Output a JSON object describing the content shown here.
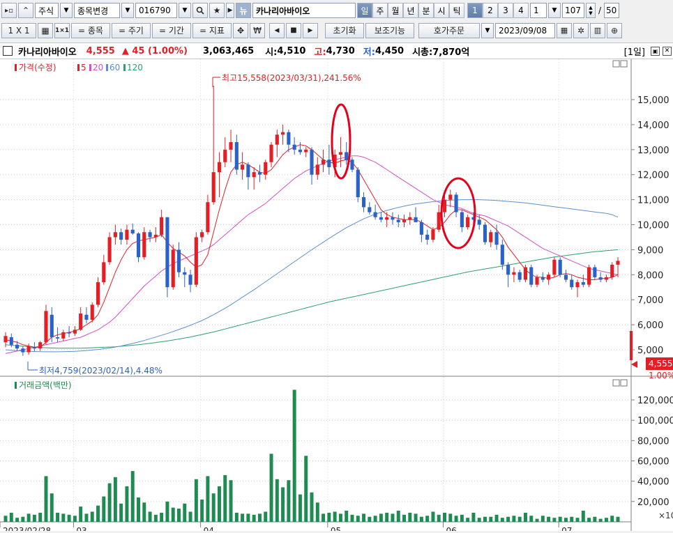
{
  "toolbar1": {
    "market": "주식",
    "change_label": "종목변경",
    "code": "016790",
    "news": "뉴",
    "name": "카나리아바이오",
    "periods": [
      "일",
      "주",
      "월",
      "년",
      "분",
      "시",
      "틱"
    ],
    "nums": [
      "1",
      "2",
      "3",
      "4"
    ],
    "num_value": "1",
    "count": "107",
    "slash": "/",
    "page": "50"
  },
  "toolbar2": {
    "layout": "1 X 1",
    "items_label": "= 종목",
    "cycle_label": "= 주기",
    "period_label": "= 기간",
    "indicator_label": "= 지표",
    "won": "₩",
    "reset": "초기화",
    "aux": "보조기능",
    "quote": "호가주문",
    "date": "2023/09/08"
  },
  "info": {
    "name": "카나리아바이오",
    "price": "4,555",
    "change": "▲ 45 (1.00%)",
    "volume": "3,063,465",
    "open_label": "시:",
    "open": "4,510",
    "high_label": "고:",
    "high": "4,730",
    "low_label": "저:",
    "low": "4,450",
    "mcap_label": "시총:",
    "mcap": "7,870억",
    "period": "[1일]"
  },
  "price_panel": {
    "legend_main": "가격(수정)",
    "legend_ma": [
      "5",
      "20",
      "60",
      "120"
    ],
    "high_note": "최고15,558(2023/03/31),241.56%",
    "low_note": "최저4,759(2023/02/14),4.48%",
    "current_price": "4,555",
    "current_pct": "1.00%"
  },
  "volume_panel": {
    "legend": "거래금액(백만)",
    "axis_unit": "×10"
  },
  "colors": {
    "up": "#e31e24",
    "down": "#2a62c9",
    "ma5": "#e31e24",
    "ma20": "#d14fc9",
    "ma60": "#5b8fcf",
    "ma120": "#2e9e6e",
    "volume": "#1f8a52",
    "circle": "#e5001a"
  },
  "chart_data": {
    "type": "candlestick",
    "price_axis_ticks": [
      "15,000",
      "14,000",
      "13,000",
      "12,000",
      "11,000",
      "10,000",
      "9,000",
      "8,000",
      "7,000",
      "6,000",
      "5,000"
    ],
    "volume_axis_ticks": [
      "120,000",
      "100,000",
      "80,000",
      "60,000",
      "40,000",
      "20,000"
    ],
    "x_labels": [
      "2023/02/28",
      "03",
      "04",
      "05",
      "06",
      "07"
    ],
    "ohlc": [
      [
        5300,
        5700,
        5100,
        5550
      ],
      [
        5500,
        5650,
        5100,
        5200
      ],
      [
        5200,
        5350,
        4950,
        5050
      ],
      [
        5050,
        5150,
        4759,
        4900
      ],
      [
        4900,
        5250,
        4800,
        5150
      ],
      [
        5100,
        5300,
        4950,
        5050
      ],
      [
        5050,
        5350,
        4950,
        5300
      ],
      [
        5300,
        6800,
        5200,
        6550
      ],
      [
        6400,
        6700,
        5300,
        5500
      ],
      [
        5500,
        5900,
        5300,
        5450
      ],
      [
        5450,
        5800,
        5350,
        5700
      ],
      [
        5700,
        5950,
        5500,
        5650
      ],
      [
        5650,
        5950,
        5550,
        5800
      ],
      [
        5800,
        6700,
        5750,
        6450
      ],
      [
        6400,
        6700,
        6050,
        6200
      ],
      [
        6200,
        6900,
        6100,
        6800
      ],
      [
        6800,
        7900,
        6700,
        7700
      ],
      [
        7700,
        8800,
        7600,
        8500
      ],
      [
        8500,
        9700,
        8400,
        9500
      ],
      [
        9500,
        10000,
        9200,
        9700
      ],
      [
        9700,
        9850,
        9200,
        9400
      ],
      [
        9400,
        10000,
        9200,
        9800
      ],
      [
        9800,
        10050,
        9600,
        9650
      ],
      [
        9650,
        9700,
        8500,
        8700
      ],
      [
        8700,
        9900,
        8600,
        9700
      ],
      [
        9700,
        9800,
        9300,
        9500
      ],
      [
        9500,
        9900,
        9300,
        9600
      ],
      [
        9600,
        10600,
        9500,
        10300
      ],
      [
        10300,
        10300,
        7100,
        7500
      ],
      [
        7500,
        9200,
        7400,
        9000
      ],
      [
        9000,
        9300,
        7900,
        8100
      ],
      [
        8100,
        8300,
        7500,
        8000
      ],
      [
        8000,
        8200,
        7300,
        7600
      ],
      [
        7600,
        9700,
        7500,
        9500
      ],
      [
        9500,
        9800,
        9300,
        9700
      ],
      [
        9700,
        11200,
        9600,
        10900
      ],
      [
        10900,
        15558,
        10800,
        12100
      ],
      [
        12100,
        12900,
        11100,
        12500
      ],
      [
        12500,
        13500,
        12300,
        13000
      ],
      [
        13000,
        13800,
        12500,
        13300
      ],
      [
        13300,
        13600,
        12000,
        12200
      ],
      [
        12200,
        12900,
        11800,
        12400
      ],
      [
        12400,
        12500,
        11400,
        11900
      ],
      [
        11900,
        12300,
        11400,
        12100
      ],
      [
        12100,
        12400,
        11700,
        12000
      ],
      [
        12000,
        12600,
        11800,
        12500
      ],
      [
        12500,
        13300,
        12300,
        13200
      ],
      [
        13200,
        13800,
        12700,
        13600
      ],
      [
        13600,
        14000,
        13200,
        13700
      ],
      [
        13700,
        13800,
        12900,
        13200
      ],
      [
        13200,
        13500,
        12800,
        13000
      ],
      [
        13000,
        13300,
        12800,
        12900
      ],
      [
        12900,
        13100,
        12700,
        13000
      ],
      [
        13000,
        13100,
        11600,
        12000
      ],
      [
        12000,
        12700,
        11800,
        12400
      ],
      [
        12400,
        13000,
        12100,
        12600
      ],
      [
        12600,
        13200,
        12000,
        12300
      ],
      [
        12300,
        13000,
        11900,
        12800
      ],
      [
        12800,
        13500,
        12300,
        12900
      ],
      [
        12900,
        13300,
        12400,
        12600
      ],
      [
        12600,
        12700,
        12100,
        12200
      ],
      [
        12200,
        12300,
        10900,
        11100
      ],
      [
        11100,
        11300,
        10500,
        10700
      ],
      [
        10700,
        10900,
        10400,
        10500
      ],
      [
        10500,
        10800,
        10200,
        10300
      ],
      [
        10300,
        10500,
        10100,
        10200
      ],
      [
        10200,
        10500,
        9900,
        10300
      ],
      [
        10300,
        10500,
        10000,
        10200
      ],
      [
        10200,
        10400,
        9900,
        10100
      ],
      [
        10100,
        10400,
        9900,
        10200
      ],
      [
        10200,
        10500,
        10000,
        10300
      ],
      [
        10300,
        10700,
        10100,
        10100
      ],
      [
        10100,
        10200,
        9300,
        9600
      ],
      [
        9600,
        9800,
        9200,
        9400
      ],
      [
        9400,
        9900,
        9300,
        9800
      ],
      [
        9800,
        10800,
        9700,
        10500
      ],
      [
        10500,
        11300,
        10300,
        11000
      ],
      [
        11000,
        11400,
        10700,
        11200
      ],
      [
        11200,
        11300,
        10300,
        10500
      ],
      [
        10500,
        10600,
        9700,
        9900
      ],
      [
        9900,
        10400,
        9800,
        10300
      ],
      [
        10300,
        10500,
        10000,
        10200
      ],
      [
        10200,
        10400,
        9800,
        10000
      ],
      [
        10000,
        10100,
        9200,
        9300
      ],
      [
        9300,
        9800,
        9100,
        9700
      ],
      [
        9700,
        10000,
        9000,
        9200
      ],
      [
        9200,
        9400,
        8200,
        8400
      ],
      [
        8400,
        8500,
        7500,
        8000
      ],
      [
        8000,
        8300,
        7700,
        8100
      ],
      [
        8100,
        8200,
        7700,
        7800
      ],
      [
        7800,
        8400,
        7700,
        8300
      ],
      [
        8300,
        8400,
        7500,
        7600
      ],
      [
        7600,
        8000,
        7500,
        7900
      ],
      [
        7900,
        8100,
        7700,
        7800
      ],
      [
        7800,
        8100,
        7600,
        8000
      ],
      [
        8000,
        8700,
        7900,
        8600
      ],
      [
        8600,
        8700,
        7900,
        8000
      ],
      [
        8000,
        8200,
        7700,
        7800
      ],
      [
        7800,
        8000,
        7400,
        7500
      ],
      [
        7500,
        7800,
        7100,
        7700
      ],
      [
        7700,
        8000,
        7500,
        7600
      ],
      [
        7600,
        8400,
        7500,
        8300
      ],
      [
        8300,
        8400,
        7800,
        7900
      ],
      [
        7900,
        8100,
        7700,
        7800
      ],
      [
        7800,
        8000,
        7700,
        7900
      ],
      [
        7900,
        8500,
        7800,
        8400
      ],
      [
        8400,
        8700,
        7900,
        8555
      ]
    ],
    "ma5": [
      5400,
      5350,
      5300,
      5200,
      5150,
      5100,
      5100,
      5300,
      5500,
      5600,
      5650,
      5700,
      5750,
      5850,
      6000,
      6150,
      6400,
      6900,
      7500,
      8100,
      8600,
      9000,
      9250,
      9350,
      9400,
      9450,
      9500,
      9600,
      9300,
      9050,
      8900,
      8750,
      8500,
      8300,
      8400,
      8800,
      9700,
      10600,
      11400,
      12100,
      12400,
      12500,
      12400,
      12250,
      12100,
      12050,
      12200,
      12500,
      12800,
      13000,
      13100,
      13200,
      13150,
      13000,
      12800,
      12600,
      12500,
      12450,
      12550,
      12600,
      12500,
      12200,
      11800,
      11400,
      11000,
      10600,
      10400,
      10300,
      10250,
      10200,
      10200,
      10200,
      10100,
      9950,
      9800,
      9900,
      10100,
      10400,
      10600,
      10600,
      10500,
      10400,
      10300,
      10200,
      10000,
      9800,
      9500,
      9100,
      8800,
      8500,
      8200,
      8000,
      7900,
      7900,
      7850,
      7900,
      8000,
      8050,
      8000,
      7900,
      7850,
      7800,
      7800,
      7850,
      7850,
      7900,
      8000
    ],
    "ma20": [
      4850,
      4900,
      4950,
      5000,
      5050,
      5100,
      5150,
      5200,
      5250,
      5300,
      5350,
      5400,
      5450,
      5500,
      5600,
      5700,
      5800,
      5950,
      6100,
      6300,
      6550,
      6800,
      7050,
      7300,
      7550,
      7750,
      7950,
      8150,
      8300,
      8450,
      8550,
      8650,
      8750,
      8850,
      8950,
      9050,
      9200,
      9400,
      9600,
      9800,
      10000,
      10200,
      10400,
      10550,
      10700,
      10850,
      11050,
      11250,
      11450,
      11650,
      11850,
      12000,
      12150,
      12250,
      12350,
      12450,
      12550,
      12600,
      12650,
      12700,
      12750,
      12750,
      12700,
      12600,
      12500,
      12350,
      12200,
      12050,
      11900,
      11750,
      11600,
      11450,
      11300,
      11150,
      11000,
      10900,
      10800,
      10750,
      10700,
      10650,
      10550,
      10450,
      10400,
      10350,
      10250,
      10150,
      10050,
      9950,
      9800,
      9650,
      9500,
      9350,
      9200,
      9050,
      8950,
      8850,
      8750,
      8650,
      8550,
      8450,
      8350,
      8250,
      8200,
      8150,
      8100,
      8050,
      8000
    ],
    "ma60": [
      5000,
      4980,
      4960,
      4950,
      4940,
      4930,
      4925,
      4920,
      4920,
      4920,
      4925,
      4930,
      4940,
      4950,
      4970,
      4990,
      5010,
      5040,
      5070,
      5110,
      5150,
      5200,
      5250,
      5310,
      5370,
      5440,
      5510,
      5580,
      5650,
      5730,
      5810,
      5890,
      5980,
      6070,
      6170,
      6280,
      6400,
      6530,
      6660,
      6800,
      6950,
      7100,
      7250,
      7400,
      7560,
      7720,
      7880,
      8040,
      8200,
      8360,
      8520,
      8680,
      8840,
      9000,
      9150,
      9300,
      9450,
      9600,
      9740,
      9880,
      10000,
      10120,
      10230,
      10330,
      10420,
      10500,
      10570,
      10630,
      10690,
      10740,
      10790,
      10830,
      10860,
      10890,
      10920,
      10940,
      10960,
      10980,
      10990,
      11000,
      11000,
      11000,
      11000,
      10990,
      10980,
      10970,
      10950,
      10930,
      10910,
      10890,
      10870,
      10840,
      10810,
      10780,
      10750,
      10720,
      10690,
      10660,
      10630,
      10600,
      10570,
      10540,
      10510,
      10480,
      10450,
      10400,
      10300
    ],
    "ma120": [
      5200,
      5180,
      5160,
      5140,
      5120,
      5100,
      5090,
      5080,
      5070,
      5060,
      5060,
      5060,
      5060,
      5060,
      5070,
      5080,
      5090,
      5100,
      5110,
      5120,
      5140,
      5160,
      5180,
      5200,
      5230,
      5260,
      5290,
      5320,
      5350,
      5390,
      5430,
      5470,
      5510,
      5560,
      5610,
      5660,
      5710,
      5770,
      5830,
      5890,
      5950,
      6010,
      6070,
      6130,
      6190,
      6250,
      6310,
      6370,
      6430,
      6490,
      6550,
      6610,
      6670,
      6730,
      6790,
      6850,
      6910,
      6960,
      7010,
      7060,
      7110,
      7160,
      7210,
      7260,
      7310,
      7360,
      7410,
      7460,
      7510,
      7560,
      7610,
      7660,
      7710,
      7760,
      7810,
      7860,
      7910,
      7960,
      8010,
      8060,
      8110,
      8150,
      8190,
      8230,
      8270,
      8310,
      8350,
      8390,
      8430,
      8470,
      8510,
      8550,
      8590,
      8630,
      8670,
      8710,
      8740,
      8770,
      8800,
      8830,
      8860,
      8890,
      8920,
      8940,
      8960,
      8980,
      9000
    ],
    "volume": [
      6000,
      9000,
      4000,
      5000,
      8000,
      7000,
      9000,
      45000,
      28000,
      9000,
      8000,
      7000,
      6000,
      15000,
      8000,
      10000,
      16000,
      25000,
      38000,
      44000,
      18000,
      35000,
      50000,
      24000,
      19000,
      10000,
      7000,
      9000,
      20000,
      14000,
      13000,
      18000,
      10000,
      42000,
      22000,
      45000,
      28000,
      35000,
      46000,
      41000,
      9000,
      8000,
      8000,
      7000,
      8000,
      10000,
      67000,
      42000,
      34000,
      41000,
      130000,
      27000,
      65000,
      29000,
      19000,
      8000,
      9000,
      10000,
      8000,
      11000,
      7000,
      6000,
      8000,
      5000,
      6000,
      8000,
      9000,
      8000,
      11000,
      7000,
      9000,
      8000,
      5000,
      6000,
      10000,
      7000,
      9000,
      8000,
      6000,
      7000,
      4000,
      9000,
      4000,
      5000,
      5000,
      7000,
      4000,
      5000,
      6000,
      5000,
      9000,
      6000,
      3000,
      6000,
      5000,
      4000,
      5000,
      4000,
      5000,
      4000,
      11000,
      4000,
      5000,
      3000,
      4000,
      6000,
      5000
    ]
  }
}
